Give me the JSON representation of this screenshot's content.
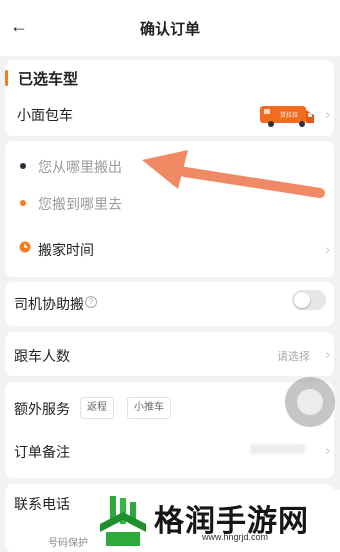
{
  "header": {
    "back_icon": "arrow-left-icon",
    "title": "确认订单"
  },
  "vehicle": {
    "section_title": "已选车型",
    "name": "小面包车",
    "van_text": "货拉拉"
  },
  "route": {
    "from_placeholder": "您从哪里搬出",
    "to_placeholder": "您搬到哪里去",
    "time_label": "搬家时间",
    "from_dot_color": "#2a2a3a",
    "to_dot_color": "#f57c1f"
  },
  "driver_help": {
    "label": "司机协助搬",
    "help_icon": "question-circle-icon",
    "toggle_on": false
  },
  "passengers": {
    "label": "跟车人数",
    "value": "请选择"
  },
  "extra_service": {
    "label": "额外服务",
    "chips": [
      "返程",
      "小推车"
    ]
  },
  "order_note": {
    "label": "订单备注"
  },
  "contact": {
    "label": "联系电话"
  },
  "footer": {
    "hint": "号码保护"
  },
  "watermark": {
    "text": "格润手游网",
    "url": "www.hngrjd.com"
  },
  "colors": {
    "accent": "#f57c1f",
    "arrow": "#f08a64"
  }
}
